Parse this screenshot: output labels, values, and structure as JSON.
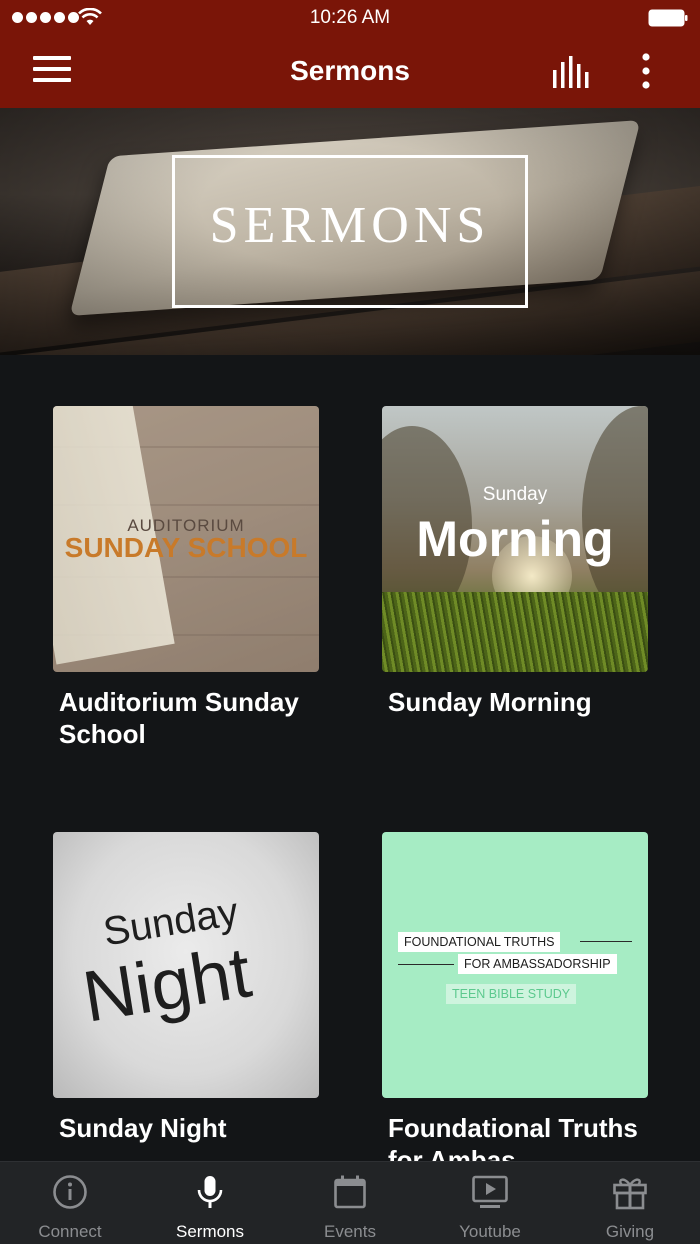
{
  "status_bar": {
    "time": "10:26 AM"
  },
  "nav": {
    "title": "Sermons",
    "menu_icon": "hamburger-menu-icon",
    "audio_icon": "equalizer-icon",
    "more_icon": "more-vertical-icon"
  },
  "hero": {
    "title": "SERMONS"
  },
  "cards": [
    {
      "title": "Auditorium Sunday School",
      "art_line1": "AUDITORIUM",
      "art_line2": "SUNDAY SCHOOL"
    },
    {
      "title": "Sunday Morning",
      "art_line1": "Sunday",
      "art_line2": "Morning"
    },
    {
      "title": "Sunday Night",
      "art_line1": "Sunday",
      "art_line2": "Night"
    },
    {
      "title": "Foundational Truths for Ambas…",
      "art_line1": "FOUNDATIONAL TRUTHS",
      "art_line2": "FOR AMBASSADORSHIP",
      "art_line3": "TEEN BIBLE STUDY"
    }
  ],
  "tabs": [
    {
      "label": "Connect",
      "icon": "info-icon"
    },
    {
      "label": "Sermons",
      "icon": "microphone-icon",
      "active": true
    },
    {
      "label": "Events",
      "icon": "calendar-icon"
    },
    {
      "label": "Youtube",
      "icon": "video-play-icon"
    },
    {
      "label": "Giving",
      "icon": "gift-icon"
    }
  ],
  "colors": {
    "nav_bg": "#7a1508",
    "page_bg": "#131517",
    "tabbar_bg": "#222426",
    "tab_active": "#ffffff",
    "tab_inactive": "#8b8d90",
    "card4_bg": "#a6ecc4"
  }
}
